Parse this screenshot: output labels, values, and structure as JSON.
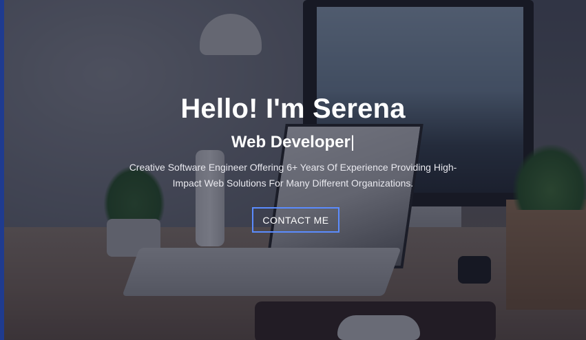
{
  "hero": {
    "title": "Hello! I'm Serena",
    "subtitle": "Web Developer",
    "cursor": "|",
    "description": "Creative Software Engineer Offering 6+ Years Of Experience Providing High-Impact Web Solutions For Many Different Organizations.",
    "cta_label": "CONTACT ME",
    "background_image": "desk-workspace-photo"
  },
  "colors": {
    "accent": "#5b8cff",
    "overlay": "#0e1226",
    "text": "#ffffff",
    "edge_bar": "#1f3b8f"
  }
}
